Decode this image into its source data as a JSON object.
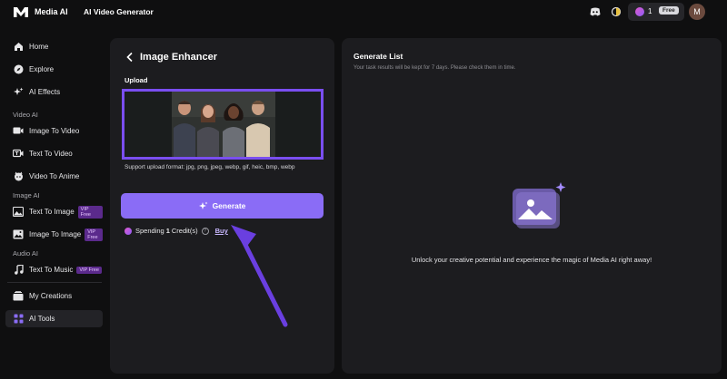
{
  "topbar": {
    "brand": "Media AI",
    "product": "AI Video Generator",
    "credits": "1",
    "free_badge": "Free",
    "avatar_initial": "M",
    "icons": [
      "discord-icon",
      "theme-toggle-icon",
      "credit-coin-icon"
    ]
  },
  "sidebar": {
    "top_items": [
      {
        "label": "Home",
        "icon": "home-icon"
      },
      {
        "label": "Explore",
        "icon": "compass-icon"
      },
      {
        "label": "AI Effects",
        "icon": "sparkles-icon"
      }
    ],
    "sections": [
      {
        "label": "Video AI",
        "items": [
          {
            "label": "Image To Video",
            "icon": "image-video-icon"
          },
          {
            "label": "Text To Video",
            "icon": "text-video-icon"
          },
          {
            "label": "Video To Anime",
            "icon": "anime-icon"
          }
        ]
      },
      {
        "label": "Image AI",
        "items": [
          {
            "label": "Text To Image",
            "icon": "text-image-icon",
            "badge": "VIP Free"
          },
          {
            "label": "Image To Image",
            "icon": "image-image-icon",
            "badge": "VIP Free"
          }
        ]
      },
      {
        "label": "Audio AI",
        "items": [
          {
            "label": "Text To Music",
            "icon": "music-icon",
            "badge": "VIP Free"
          }
        ]
      }
    ],
    "bottom_items": [
      {
        "label": "My Creations",
        "icon": "creations-icon"
      },
      {
        "label": "AI Tools",
        "icon": "tools-grid-icon",
        "active": true
      }
    ]
  },
  "tool": {
    "title": "Image Enhancer",
    "upload_label": "Upload",
    "format_note": "Support upload format: jpg, png, jpeg, webp, gif, heic, bmp, webp",
    "generate_label": "Generate",
    "spending_prefix": "Spending",
    "spending_amount": "1",
    "spending_suffix": "Credit(s)",
    "buy_label": "Buy"
  },
  "generate_list": {
    "title": "Generate List",
    "subtitle": "Your task results will be kept for 7 days. Please check them in time.",
    "empty_message": "Unlock your creative potential and experience the magic of Media AI right away!"
  },
  "colors": {
    "accent": "#8a6cf6",
    "upload_border": "#7a4ef0",
    "arrow": "#6a3fe0",
    "panel_bg": "#1c1c1f",
    "page_bg": "#0f0f10"
  }
}
